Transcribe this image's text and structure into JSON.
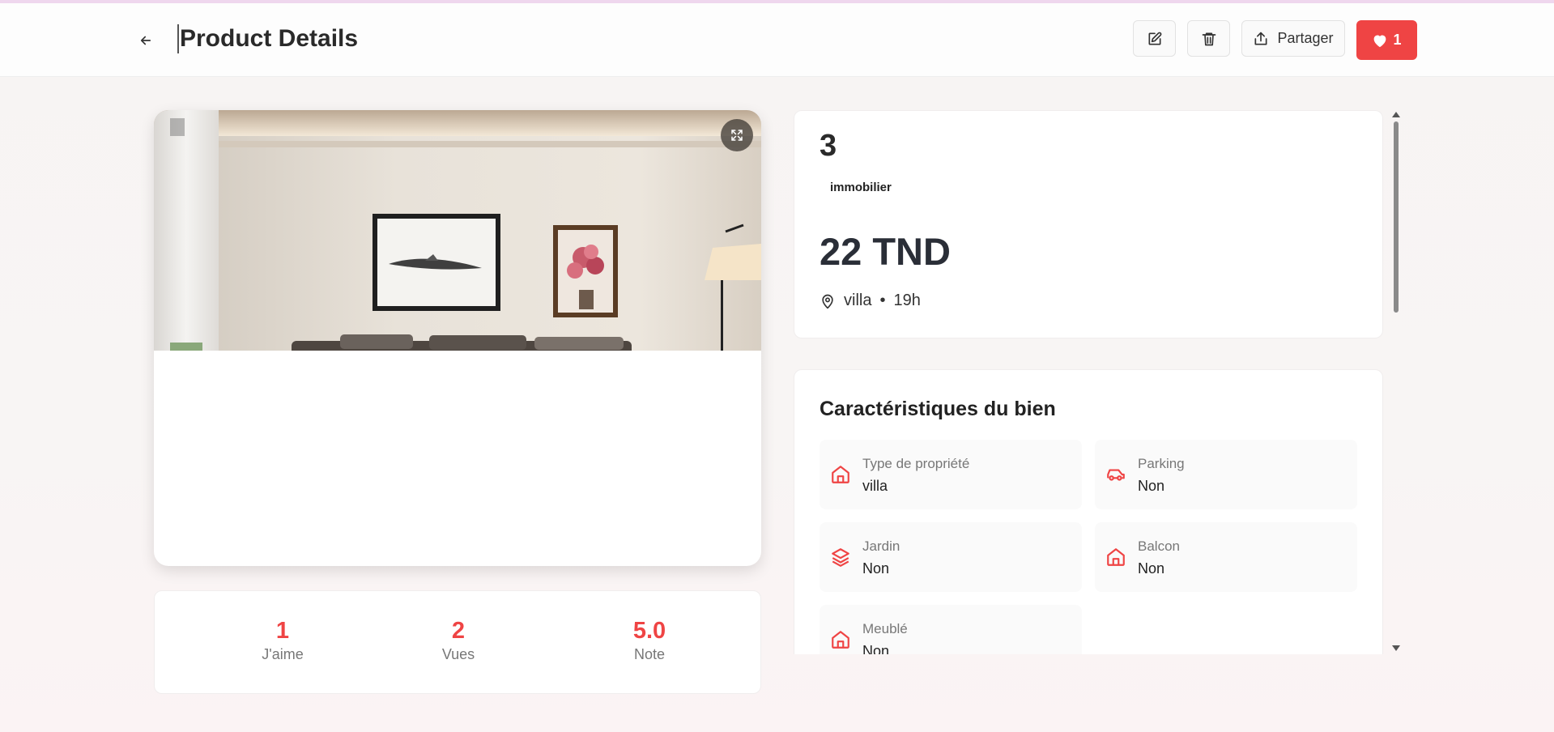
{
  "header": {
    "title": "Product Details",
    "share_label": "Partager",
    "like_count": "1"
  },
  "colors": {
    "accent": "#ef4444"
  },
  "stats": [
    {
      "value": "1",
      "label": "J'aime"
    },
    {
      "value": "2",
      "label": "Vues"
    },
    {
      "value": "5.0",
      "label": "Note"
    }
  ],
  "product": {
    "name": "3",
    "category": "immobilier",
    "price": "22 TND",
    "location": "villa",
    "separator": "•",
    "time": "19h"
  },
  "features": {
    "title": "Caractéristiques du bien",
    "items": [
      {
        "label": "Type de propriété",
        "value": "villa",
        "icon": "home-icon"
      },
      {
        "label": "Parking",
        "value": "Non",
        "icon": "car-icon"
      },
      {
        "label": "Jardin",
        "value": "Non",
        "icon": "layers-icon"
      },
      {
        "label": "Balcon",
        "value": "Non",
        "icon": "home-icon"
      },
      {
        "label": "Meublé",
        "value": "Non",
        "icon": "home-icon"
      }
    ]
  }
}
